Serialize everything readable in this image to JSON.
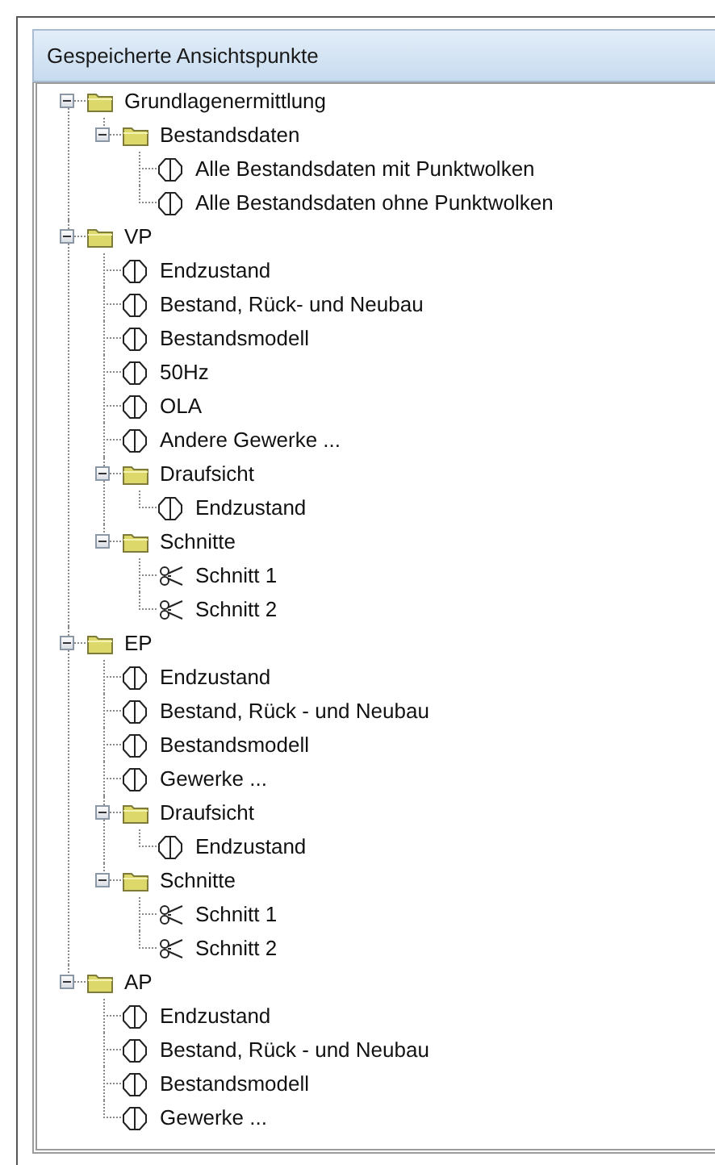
{
  "panel": {
    "title": "Gespeicherte Ansichtspunkte"
  },
  "tree": [
    {
      "kind": "folder",
      "label": "Grundlagenermittlung",
      "expanded": true,
      "children": [
        {
          "kind": "folder",
          "label": "Bestandsdaten",
          "expanded": true,
          "children": [
            {
              "kind": "view",
              "label": "Alle Bestandsdaten mit Punktwolken"
            },
            {
              "kind": "view",
              "label": "Alle Bestandsdaten ohne Punktwolken"
            }
          ]
        }
      ]
    },
    {
      "kind": "folder",
      "label": "VP",
      "expanded": true,
      "children": [
        {
          "kind": "view",
          "label": "Endzustand"
        },
        {
          "kind": "view",
          "label": "Bestand, Rück- und Neubau"
        },
        {
          "kind": "view",
          "label": "Bestandsmodell"
        },
        {
          "kind": "view",
          "label": "50Hz"
        },
        {
          "kind": "view",
          "label": "OLA"
        },
        {
          "kind": "view",
          "label": "Andere Gewerke ..."
        },
        {
          "kind": "folder",
          "label": "Draufsicht",
          "expanded": true,
          "children": [
            {
              "kind": "view",
              "label": "Endzustand"
            }
          ]
        },
        {
          "kind": "folder",
          "label": "Schnitte",
          "expanded": true,
          "children": [
            {
              "kind": "section",
              "label": "Schnitt 1"
            },
            {
              "kind": "section",
              "label": "Schnitt 2"
            }
          ]
        }
      ]
    },
    {
      "kind": "folder",
      "label": "EP",
      "expanded": true,
      "children": [
        {
          "kind": "view",
          "label": "Endzustand"
        },
        {
          "kind": "view",
          "label": "Bestand, Rück - und Neubau"
        },
        {
          "kind": "view",
          "label": "Bestandsmodell"
        },
        {
          "kind": "view",
          "label": "Gewerke ..."
        },
        {
          "kind": "folder",
          "label": "Draufsicht",
          "expanded": true,
          "children": [
            {
              "kind": "view",
              "label": "Endzustand"
            }
          ]
        },
        {
          "kind": "folder",
          "label": "Schnitte",
          "expanded": true,
          "children": [
            {
              "kind": "section",
              "label": "Schnitt 1"
            },
            {
              "kind": "section",
              "label": "Schnitt 2"
            }
          ]
        }
      ]
    },
    {
      "kind": "folder",
      "label": "AP",
      "expanded": true,
      "children": [
        {
          "kind": "view",
          "label": "Endzustand"
        },
        {
          "kind": "view",
          "label": "Bestand, Rück - und Neubau"
        },
        {
          "kind": "view",
          "label": "Bestandsmodell"
        },
        {
          "kind": "view",
          "label": "Gewerke ..."
        }
      ]
    }
  ]
}
